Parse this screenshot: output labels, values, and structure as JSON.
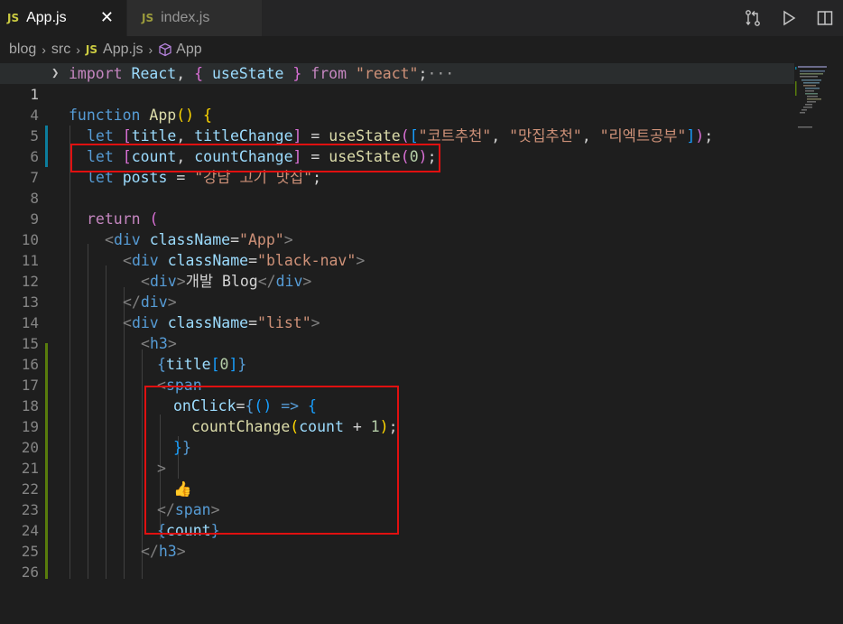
{
  "tabs": [
    {
      "badge": "JS",
      "label": "App.js",
      "close": "✕"
    },
    {
      "badge": "JS",
      "label": "index.js"
    }
  ],
  "breadcrumb": {
    "items": [
      "blog",
      "src",
      "App.js",
      "App"
    ],
    "file_badge": "JS",
    "separator": "›"
  },
  "editor": {
    "lines": [
      {
        "n": "1"
      },
      {
        "n": "4"
      },
      {
        "n": "5"
      },
      {
        "n": "6"
      },
      {
        "n": "7"
      },
      {
        "n": "8"
      },
      {
        "n": "9"
      },
      {
        "n": "10"
      },
      {
        "n": "11"
      },
      {
        "n": "12"
      },
      {
        "n": "13"
      },
      {
        "n": "14"
      },
      {
        "n": "15"
      },
      {
        "n": "16"
      },
      {
        "n": "17"
      },
      {
        "n": "18"
      },
      {
        "n": "19"
      },
      {
        "n": "20"
      },
      {
        "n": "21"
      },
      {
        "n": "22"
      },
      {
        "n": "23"
      },
      {
        "n": "24"
      },
      {
        "n": "25"
      },
      {
        "n": "26"
      }
    ],
    "code": {
      "l1": {
        "import": "import",
        "react": "React",
        "comma": ",",
        "lb": "{",
        "usestate": "useState",
        "rb": "}",
        "from": "from",
        "mod": "\"react\"",
        "semi": ";",
        "ell": "···"
      },
      "l5": {
        "function": "function",
        "name": "App",
        "parens": "()",
        "lb": "{"
      },
      "l6": {
        "let": "let",
        "lb": "[",
        "a": "title",
        "comma": ",",
        "b": "titleChange",
        "rb": "]",
        "eq": "=",
        "fn": "useState",
        "lp": "(",
        "alb": "[",
        "s1": "\"코트추천\"",
        "c1": ",",
        "s2": "\"맛집추천\"",
        "c2": ",",
        "s3": "\"리엑트공부\"",
        "arb": "]",
        "rp": ")",
        "semi": ";"
      },
      "l7": {
        "let": "let",
        "lb": "[",
        "a": "count",
        "comma": ",",
        "b": "countChange",
        "rb": "]",
        "eq": "=",
        "fn": "useState",
        "lp": "(",
        "num": "0",
        "rp": ")",
        "semi": ";"
      },
      "l8": {
        "let": "let",
        "a": "posts",
        "eq": "=",
        "s": "\"강남 고기 맛집\"",
        "semi": ";"
      },
      "l10": {
        "ret": "return",
        "lp": "("
      },
      "l11": {
        "open": "<",
        "tag": "div",
        "attr": "className",
        "eq": "=",
        "val": "\"App\"",
        "close": ">"
      },
      "l12": {
        "open": "<",
        "tag": "div",
        "attr": "className",
        "eq": "=",
        "val": "\"black-nav\"",
        "close": ">"
      },
      "l13": {
        "open": "<",
        "tag": "div",
        "close": ">",
        "text": "개발 Blog",
        "eopen": "</",
        "etag": "div",
        "eclose": ">"
      },
      "l14": {
        "eopen": "</",
        "etag": "div",
        "eclose": ">"
      },
      "l15": {
        "open": "<",
        "tag": "div",
        "attr": "className",
        "eq": "=",
        "val": "\"list\"",
        "close": ">"
      },
      "l16": {
        "open": "<",
        "tag": "h3",
        "close": ">"
      },
      "l17": {
        "lb": "{",
        "var": "title",
        "alb": "[",
        "num": "0",
        "arb": "]",
        "rb": "}"
      },
      "l18": {
        "open": "<",
        "tag": "span"
      },
      "l19": {
        "attr": "onClick",
        "eq": "=",
        "lb": "{",
        "parens": "()",
        "arrow": "=>",
        "blb": "{"
      },
      "l20": {
        "fn": "countChange",
        "lp": "(",
        "var": "count",
        "plus": "+",
        "num": "1",
        "rp": ")",
        "semi": ";"
      },
      "l21": {
        "brb": "}",
        "rb": "}"
      },
      "l22": {
        "close": ">"
      },
      "l23": {
        "emoji": "👍"
      },
      "l24": {
        "eopen": "</",
        "etag": "span",
        "eclose": ">"
      },
      "l25": {
        "lb": "{",
        "var": "count",
        "rb": "}"
      },
      "l26": {
        "eopen": "</",
        "etag": "h3",
        "eclose": ">"
      }
    }
  },
  "colors": {
    "keyword": "#569cd6",
    "control": "#c586c0",
    "function": "#dcdcaa",
    "variable": "#9cdcfe",
    "string": "#ce9178",
    "number": "#b5cea8",
    "annotation_box": "#e01010"
  },
  "icons": [
    "open-changes-icon",
    "run-icon",
    "split-editor-icon",
    "react-component-icon"
  ]
}
